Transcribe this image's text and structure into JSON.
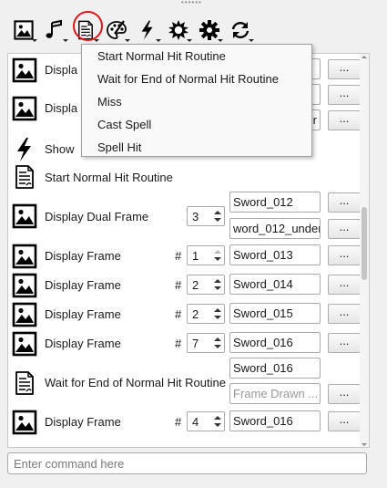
{
  "toolbar": {
    "tools": [
      {
        "name": "image-icon"
      },
      {
        "name": "music-note-icon"
      },
      {
        "name": "script-icon"
      },
      {
        "name": "palette-icon"
      },
      {
        "name": "lightning-icon"
      },
      {
        "name": "burst-icon"
      },
      {
        "name": "gear-icon"
      },
      {
        "name": "loop-arrows-icon"
      }
    ]
  },
  "menu": {
    "items": [
      "Start Normal Hit Routine",
      "Wait for End of Normal Hit Routine",
      "Miss",
      "Cast Spell",
      "Spell Hit"
    ]
  },
  "commands": [
    {
      "icon": "image-icon",
      "label": "Displa",
      "field": "",
      "button": "..."
    },
    {
      "icon": "image-icon",
      "label": "Displa",
      "field": "",
      "field2": "r",
      "button": "...",
      "button2": "..."
    },
    {
      "icon": "lightning-icon",
      "label": "Show"
    },
    {
      "icon": "script-icon",
      "label": "Start Normal Hit Routine"
    },
    {
      "icon": "image-icon",
      "label": "Display Dual Frame",
      "spin": "3",
      "field": "Sword_012",
      "field2": "word_012_under",
      "button": "...",
      "button2": "..."
    },
    {
      "icon": "image-icon",
      "label": "Display Frame",
      "hash": "#",
      "spin": "1",
      "field": "Sword_013",
      "button": "..."
    },
    {
      "icon": "image-icon",
      "label": "Display Frame",
      "hash": "#",
      "spin": "2",
      "field": "Sword_014",
      "button": "..."
    },
    {
      "icon": "image-icon",
      "label": "Display Frame",
      "hash": "#",
      "spin": "2",
      "field": "Sword_015",
      "button": "..."
    },
    {
      "icon": "image-icon",
      "label": "Display Frame",
      "hash": "#",
      "spin": "7",
      "field": "Sword_016",
      "button": "..."
    },
    {
      "icon": "script-icon",
      "label": "Wait for End of Normal Hit Routine",
      "field": "Sword_016",
      "field2_placeholder": "Frame Drawn ...",
      "button2": "..."
    },
    {
      "icon": "image-icon",
      "label": "Display Frame",
      "hash": "#",
      "spin": "4",
      "field": "Sword_016",
      "button": "..."
    }
  ],
  "command_input": {
    "placeholder": "Enter command here"
  }
}
